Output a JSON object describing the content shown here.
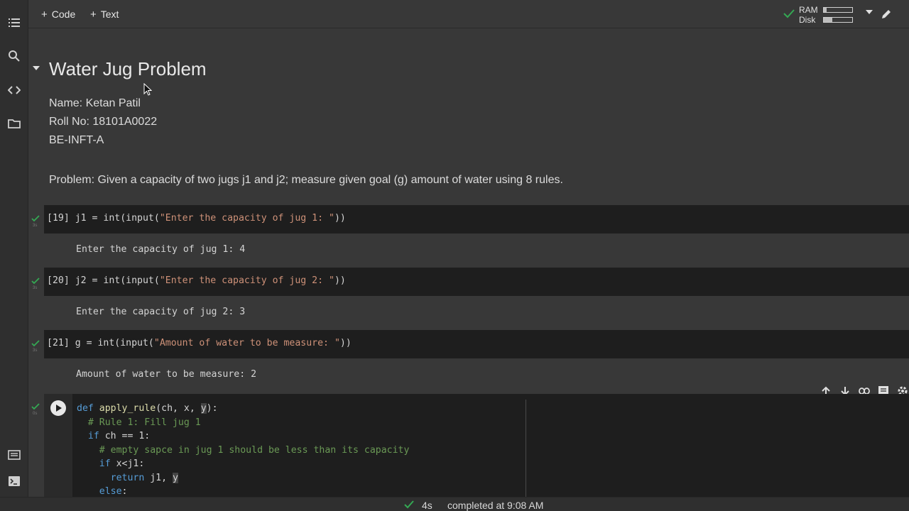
{
  "toolbar": {
    "add_code_label": "Code",
    "add_text_label": "Text",
    "ram_label": "RAM",
    "disk_label": "Disk",
    "ram_usage": 0.1,
    "disk_usage": 0.3
  },
  "notebook": {
    "title": "Water Jug Problem",
    "info_lines": [
      "Name: Ketan Patil",
      "Roll No: 18101A0022",
      "BE-INFT-A"
    ],
    "problem": "Problem: Given a capacity of two jugs j1 and j2; measure given goal (g) amount of water using 8 rules.",
    "cells": [
      {
        "exec_count": "[19]",
        "code_prefix": "j1 = int(input(",
        "code_string": "\"Enter the capacity of jug 1: \"",
        "code_suffix": "))",
        "output": "Enter the capacity of jug 1: 4",
        "status_time": "3s"
      },
      {
        "exec_count": "[20]",
        "code_prefix": "j2 = int(input(",
        "code_string": "\"Enter the capacity of jug 2: \"",
        "code_suffix": "))",
        "output": "Enter the capacity of jug 2: 3",
        "status_time": "3s"
      },
      {
        "exec_count": "[21]",
        "code_prefix": "g = int(input(",
        "code_string": "\"Amount of water to be measure: \"",
        "code_suffix": "))",
        "output": "Amount of water to be measure: 2",
        "status_time": "3s"
      }
    ],
    "last_cell": {
      "status_time": "0s",
      "lines": {
        "l1_kw": "def",
        "l1_fn": "apply_rule",
        "l1_a": "(ch, x, ",
        "l1_hl": "y",
        "l1_b": "):",
        "l2": "  # Rule 1: Fill jug 1",
        "l3_kw": "  if",
        "l3_rest": " ch == 1:",
        "l4": "    # empty sapce in jug 1 should be less than its capacity",
        "l5_kw": "    if",
        "l5_rest": " x<j1:",
        "l6_kw": "      return",
        "l6_a": " j1, ",
        "l6_hl": "y",
        "l7_kw": "    else",
        "l7_rest": ":"
      }
    }
  },
  "status_bar": {
    "duration": "4s",
    "completed": "completed at 9:08 AM"
  },
  "colors": {
    "check_green": "#34a853",
    "code_bg": "#1e1e1e",
    "page_bg": "#383838"
  }
}
